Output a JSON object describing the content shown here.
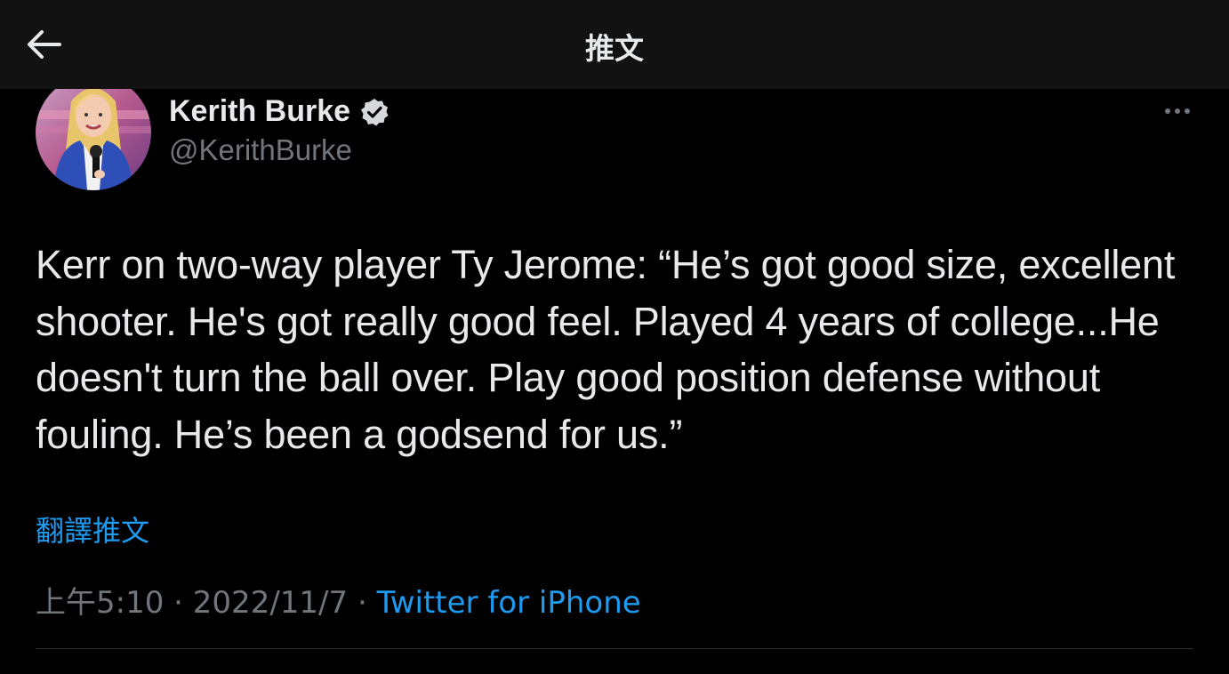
{
  "header": {
    "title": "推文",
    "back_icon": "arrow-left-icon"
  },
  "author": {
    "name": "Kerith Burke",
    "handle": "@KerithBurke",
    "verified": true,
    "avatar_icon": "avatar-illustration",
    "more_icon": "more-horizontal-icon"
  },
  "tweet": {
    "text": "Kerr on two-way player Ty Jerome: “He’s got good size, excellent shooter. He's got really good feel. Played 4 years of college...He doesn't turn the ball over. Play good position defense without fouling. He’s been a godsend for us.”",
    "translate_label": "翻譯推文",
    "time": "上午5:10",
    "separator": " · ",
    "date": "2022/11/7",
    "source": "Twitter for iPhone"
  },
  "colors": {
    "background": "#000000",
    "header_bg": "#121212",
    "text_primary": "#e7e9ea",
    "text_secondary": "#71767b",
    "link": "#1d9bf0",
    "divider": "#2f3336"
  }
}
